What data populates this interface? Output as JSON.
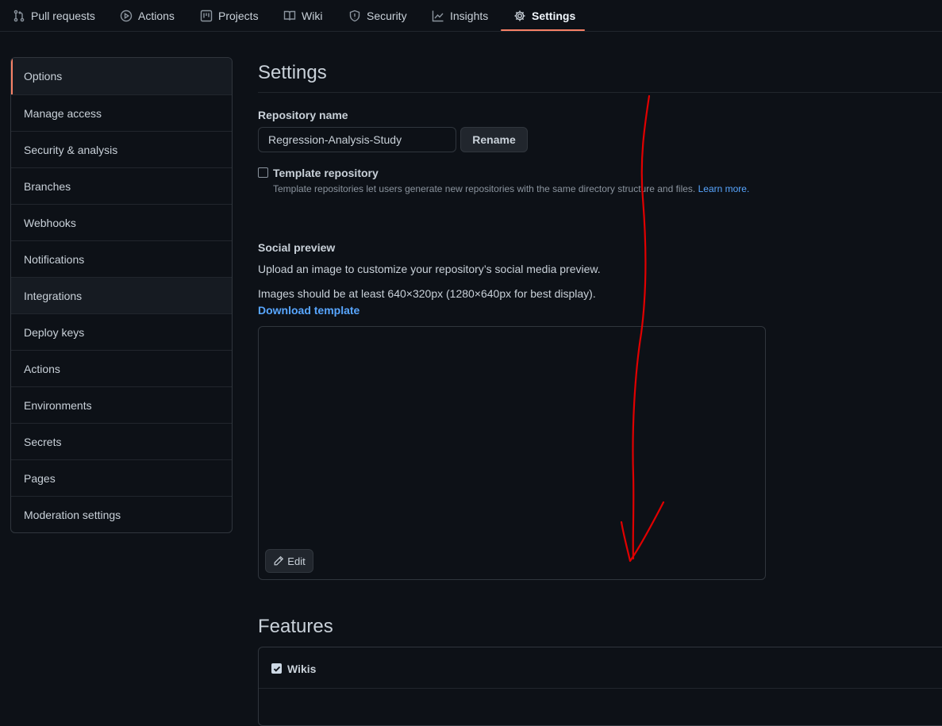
{
  "nav": {
    "tabs": [
      {
        "label": "Pull requests",
        "icon": "pull-request-icon"
      },
      {
        "label": "Actions",
        "icon": "play-icon"
      },
      {
        "label": "Projects",
        "icon": "project-icon"
      },
      {
        "label": "Wiki",
        "icon": "book-icon"
      },
      {
        "label": "Security",
        "icon": "shield-icon"
      },
      {
        "label": "Insights",
        "icon": "graph-icon"
      },
      {
        "label": "Settings",
        "icon": "gear-icon",
        "active": true
      }
    ]
  },
  "sidebar": {
    "items": [
      {
        "label": "Options"
      },
      {
        "label": "Manage access"
      },
      {
        "label": "Security & analysis"
      },
      {
        "label": "Branches"
      },
      {
        "label": "Webhooks"
      },
      {
        "label": "Notifications"
      },
      {
        "label": "Integrations"
      },
      {
        "label": "Deploy keys"
      },
      {
        "label": "Actions"
      },
      {
        "label": "Environments"
      },
      {
        "label": "Secrets"
      },
      {
        "label": "Pages"
      },
      {
        "label": "Moderation settings"
      }
    ]
  },
  "main": {
    "title": "Settings",
    "repo_name_label": "Repository name",
    "repo_name_value": "Regression-Analysis-Study",
    "rename_button": "Rename",
    "template_label": "Template repository",
    "template_checked": false,
    "template_note": "Template repositories let users generate new repositories with the same directory structure and files.",
    "template_learn_more": "Learn more.",
    "social_title": "Social preview",
    "social_desc": "Upload an image to customize your repository’s social media preview.",
    "social_size": "Images should be at least 640×320px (1280×640px for best display).",
    "download_template": "Download template",
    "edit_button": "Edit",
    "features_title": "Features",
    "wikis_label": "Wikis",
    "wikis_checked": true
  },
  "colors": {
    "accent_underline": "#f78166",
    "link": "#58a6ff",
    "annotation_arrow": "#e00000"
  }
}
